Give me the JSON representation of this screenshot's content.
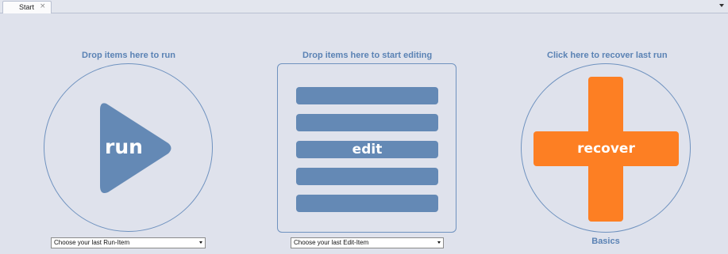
{
  "tab": {
    "label": "Start",
    "close_glyph": "×",
    "overflow_icon": "chevron-down-icon"
  },
  "run": {
    "heading": "Drop items here to run",
    "label": "run",
    "icon": "play-icon",
    "color": "#6489b5"
  },
  "edit": {
    "heading": "Drop items here to start editing",
    "label": "edit",
    "icon": "list-icon",
    "color": "#6489b5"
  },
  "recover": {
    "heading": "Click here to recover last run",
    "label": "recover",
    "icon": "plus-icon",
    "color": "#fd7f23",
    "caption": "Basics"
  },
  "dropdowns": {
    "run_item": {
      "value": "Choose your last Run-Item"
    },
    "edit_item": {
      "value": "Choose your last Edit-Item"
    }
  },
  "colors": {
    "background": "#dfe2ec",
    "heading": "#5a82b4",
    "outline": "#6f92bf"
  }
}
